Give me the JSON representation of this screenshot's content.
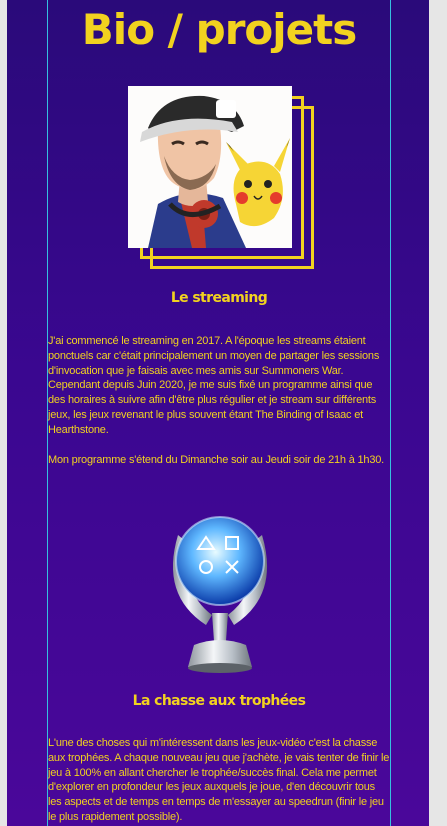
{
  "page": {
    "title": "Bio / projets",
    "colors": {
      "accent": "#f2d21f",
      "border": "#35c0e0",
      "background": "#3a0790"
    }
  },
  "streaming": {
    "heading": "Le streaming",
    "paragraph1": "J'ai commencé le streaming en 2017. A l'époque les streams étaient ponctuels car c'était principalement un moyen de partager les sessions d'invocation que je faisais avec mes amis sur Summoners War. Cependant depuis Juin 2020, je me suis fixé un programme ainsi que des horaires à suivre afin d'être plus régulier et je stream sur différents jeux, les jeux revenant le plus souvent étant The Binding of Isaac et Hearthstone.",
    "paragraph2": "Mon programme s'étend du Dimanche soir au Jeudi soir de 21h à 1h30."
  },
  "trophies": {
    "heading": "La chasse aux trophées",
    "paragraph1": "L'une des choses qui m'intéressent dans les jeux-vidéo c'est la chasse aux trophées. A chaque nouveau jeu que j'achète, je vais tenter de finir le jeu à 100% en allant chercher le trophée/succès final. Cela me permet d'explorer en profondeur les jeux auxquels je joue, d'en découvrir tous les aspects et de temps en temps de m'essayer au speedrun (finir le jeu le plus rapidement possible)."
  },
  "images": {
    "portrait": "avatar-with-pikachu",
    "trophy": "playstation-platinum-trophy-icon"
  }
}
